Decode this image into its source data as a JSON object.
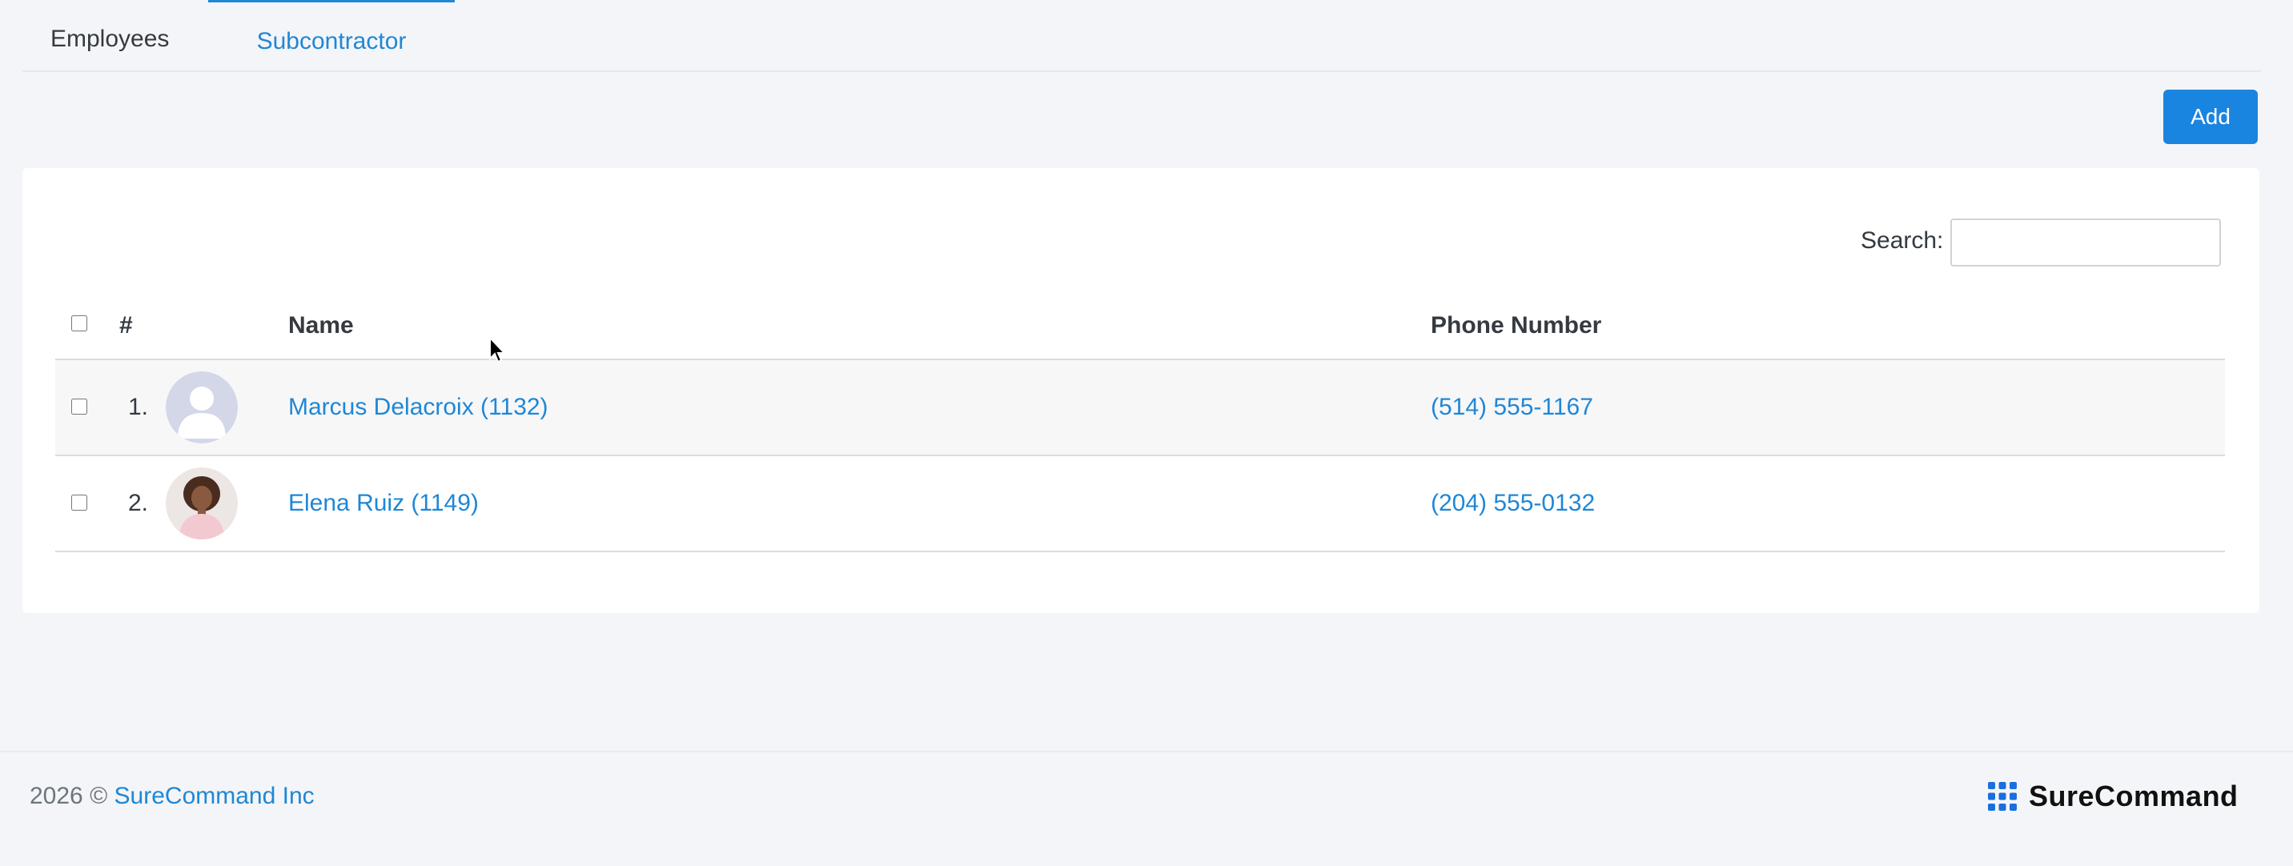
{
  "tabs": [
    {
      "label": "Employees",
      "active": false
    },
    {
      "label": "Subcontractor",
      "active": true
    }
  ],
  "toolbar": {
    "add_label": "Add"
  },
  "search": {
    "label": "Search:",
    "value": "",
    "placeholder": ""
  },
  "table": {
    "headers": {
      "number": "#",
      "name": "Name",
      "phone": "Phone Number"
    },
    "rows": [
      {
        "number": "1.",
        "name": "Marcus Delacroix (1132)",
        "phone": "(514) 555-1167",
        "avatar": "default-user-avatar"
      },
      {
        "number": "2.",
        "name": "Elena Ruiz (1149)",
        "phone": "(204) 555-0132",
        "avatar": "user-photo-avatar"
      }
    ]
  },
  "footer": {
    "year": "2026",
    "copyright_symbol": "©",
    "company_link": "SureCommand Inc",
    "brand_name": "SureCommand",
    "brand_icon": "grid-dots-icon"
  },
  "colors": {
    "accent": "#1f87d6",
    "button": "#1a85e0",
    "background": "#f4f5f8"
  }
}
